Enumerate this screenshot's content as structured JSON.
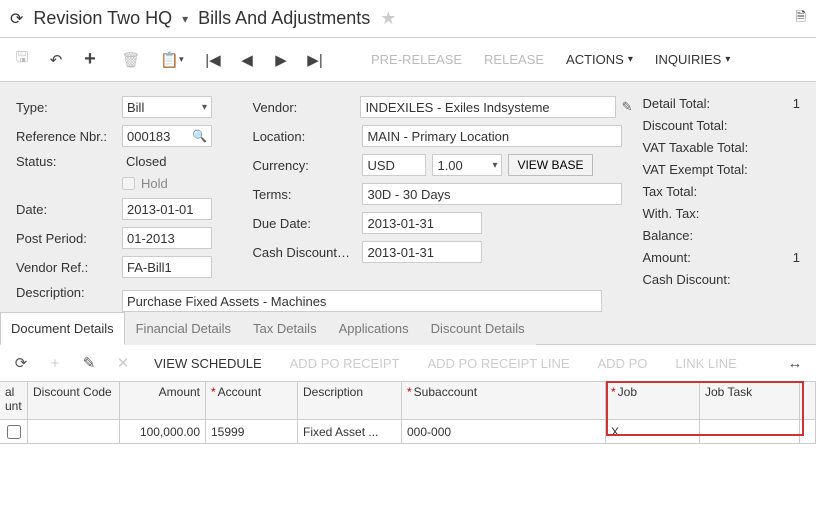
{
  "breadcrumb": {
    "item1": "Revision Two HQ",
    "item2": "Bills And Adjustments"
  },
  "toolbar": {
    "prerelease": "PRE-RELEASE",
    "release": "RELEASE",
    "actions": "ACTIONS",
    "inquiries": "INQUIRIES"
  },
  "form": {
    "type_label": "Type:",
    "type_value": "Bill",
    "refnbr_label": "Reference Nbr.:",
    "refnbr_value": "000183",
    "status_label": "Status:",
    "status_value": "Closed",
    "hold_label": "Hold",
    "date_label": "Date:",
    "date_value": "2013-01-01",
    "postperiod_label": "Post Period:",
    "postperiod_value": "01-2013",
    "vendorref_label": "Vendor Ref.:",
    "vendorref_value": "FA-Bill1",
    "description_label": "Description:",
    "description_value": "Purchase Fixed Assets - Machines",
    "vendor_label": "Vendor:",
    "vendor_value": "INDEXILES - Exiles Indsysteme",
    "location_label": "Location:",
    "location_value": "MAIN - Primary Location",
    "currency_label": "Currency:",
    "currency_value": "USD",
    "currency_rate": "1.00",
    "viewbase": "VIEW BASE",
    "terms_label": "Terms:",
    "terms_value": "30D - 30 Days",
    "duedate_label": "Due Date:",
    "duedate_value": "2013-01-31",
    "cashdisc_label": "Cash Discount…",
    "cashdisc_value": "2013-01-31",
    "detailtotal_label": "Detail Total:",
    "detailtotal_value": "1",
    "discounttotal_label": "Discount Total:",
    "vattax_label": "VAT Taxable Total:",
    "vatexempt_label": "VAT Exempt Total:",
    "taxtotal_label": "Tax Total:",
    "withtax_label": "With. Tax:",
    "balance_label": "Balance:",
    "amount_label": "Amount:",
    "amount_value": "1",
    "cashdiscount_label": "Cash Discount:"
  },
  "tabs": {
    "t1": "Document Details",
    "t2": "Financial Details",
    "t3": "Tax Details",
    "t4": "Applications",
    "t5": "Discount Details"
  },
  "gridtoolbar": {
    "viewschedule": "VIEW SCHEDULE",
    "addporeceipt": "ADD PO RECEIPT",
    "addporeceiptline": "ADD PO RECEIPT LINE",
    "addpo": "ADD PO",
    "linkline": "LINK LINE"
  },
  "grid": {
    "headers": {
      "col0": "al\nunt",
      "col1": "Discount Code",
      "col2": "Amount",
      "col3": "Account",
      "col4": "Description",
      "col5": "Subaccount",
      "col6": "Job",
      "col7": "Job Task"
    },
    "row": {
      "amount": "100,000.00",
      "account": "15999",
      "description": "Fixed Asset ...",
      "subaccount": "000-000",
      "job": "X"
    }
  }
}
